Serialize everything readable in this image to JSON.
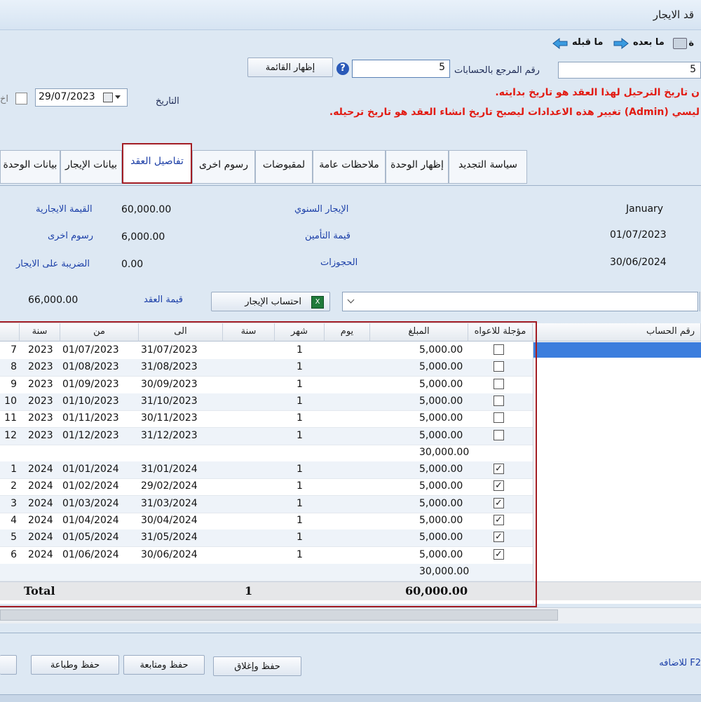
{
  "window": {
    "title": "قد الايجار"
  },
  "toolbar": {
    "prev_label": "ما قبله",
    "next_label": "ما بعده",
    "print_label": "ة"
  },
  "top": {
    "ref_label": "رقم المرجع بالحسابات",
    "ref_value": "5",
    "left_number": "5",
    "show_list_label": "إظهار القائمة",
    "date_label": "التاريخ",
    "date_value": "29/07/2023",
    "partial_label": "اخ",
    "warning1": "ن تاريخ الترحيل لهذا العقد هو تاريخ بدايته.",
    "warning2": "ليسي (Admin) تغيير هذه الاعدادات ليصبح تاريخ انشاء العقد هو تاريخ ترحيله."
  },
  "tabs": [
    {
      "label": "سياسة التجديد"
    },
    {
      "label": "إظهار الوحدة"
    },
    {
      "label": "ملاحظات عامة"
    },
    {
      "label": "لمقبوضات"
    },
    {
      "label": "رسوم اخرى"
    },
    {
      "label": "تفاصيل العقد"
    },
    {
      "label": "بيانات الإيجار"
    },
    {
      "label": "بيانات الوحدة"
    }
  ],
  "details": {
    "month": "January",
    "start_date": "01/07/2023",
    "end_date": "30/06/2024",
    "annual_rent_label": "الإيجار السنوي",
    "insurance_label": "قيمة التأمين",
    "reserved_label": "الحجوزات",
    "rent_value_label": "القيمة الايجارية",
    "rent_value": "60,000.00",
    "other_fees_label": "رسوم اخرى",
    "other_fees": "6,000.00",
    "tax_label": "الضريبة على الايجار",
    "tax": "0.00",
    "contract_value_label": "قيمة العقد",
    "contract_value": "66,000.00",
    "calc_label": "احتساب الإيجار"
  },
  "grid": {
    "headers": {
      "account": "رقم الحساب",
      "deferred": "مؤجلة للاعواه",
      "amount": "المبلغ",
      "day": "يوم",
      "month": "شهر",
      "year": "سنة",
      "to": "الى",
      "from": "من",
      "year2": "سنة"
    },
    "rows": [
      {
        "amount": "5,000.00",
        "checked": false,
        "month": "1",
        "to": "31/07/2023",
        "from": "01/07/2023",
        "year": "2023",
        "n": "7"
      },
      {
        "amount": "5,000.00",
        "checked": false,
        "month": "1",
        "to": "31/08/2023",
        "from": "01/08/2023",
        "year": "2023",
        "n": "8"
      },
      {
        "amount": "5,000.00",
        "checked": false,
        "month": "1",
        "to": "30/09/2023",
        "from": "01/09/2023",
        "year": "2023",
        "n": "9"
      },
      {
        "amount": "5,000.00",
        "checked": false,
        "month": "1",
        "to": "31/10/2023",
        "from": "01/10/2023",
        "year": "2023",
        "n": "10"
      },
      {
        "amount": "5,000.00",
        "checked": false,
        "month": "1",
        "to": "30/11/2023",
        "from": "01/11/2023",
        "year": "2023",
        "n": "11"
      },
      {
        "amount": "5,000.00",
        "checked": false,
        "month": "1",
        "to": "31/12/2023",
        "from": "01/12/2023",
        "year": "2023",
        "n": "12"
      },
      {
        "amount": "30,000.00",
        "subtotal": true
      },
      {
        "amount": "5,000.00",
        "checked": true,
        "month": "1",
        "to": "31/01/2024",
        "from": "01/01/2024",
        "year": "2024",
        "n": "1"
      },
      {
        "amount": "5,000.00",
        "checked": true,
        "month": "1",
        "to": "29/02/2024",
        "from": "01/02/2024",
        "year": "2024",
        "n": "2"
      },
      {
        "amount": "5,000.00",
        "checked": true,
        "month": "1",
        "to": "31/03/2024",
        "from": "01/03/2024",
        "year": "2024",
        "n": "3"
      },
      {
        "amount": "5,000.00",
        "checked": true,
        "month": "1",
        "to": "30/04/2024",
        "from": "01/04/2024",
        "year": "2024",
        "n": "4"
      },
      {
        "amount": "5,000.00",
        "checked": true,
        "month": "1",
        "to": "31/05/2024",
        "from": "01/05/2024",
        "year": "2024",
        "n": "5"
      },
      {
        "amount": "5,000.00",
        "checked": true,
        "month": "1",
        "to": "30/06/2024",
        "from": "01/06/2024",
        "year": "2024",
        "n": "6"
      },
      {
        "amount": "30,000.00",
        "subtotal": true
      }
    ],
    "total": {
      "label": "Total",
      "month": "1",
      "amount": "60,000.00"
    }
  },
  "footer": {
    "save_print": "حفظ وطباعة",
    "save_next": "حفظ ومتابعة",
    "save_close": "حفظ وإغلاق",
    "f2_hint": "F2 للاضافه"
  },
  "colors": {
    "accent": "#1b3fa8",
    "warning": "#e21b12",
    "highlight_border": "#a31d24",
    "selection": "#3b7ddd"
  }
}
